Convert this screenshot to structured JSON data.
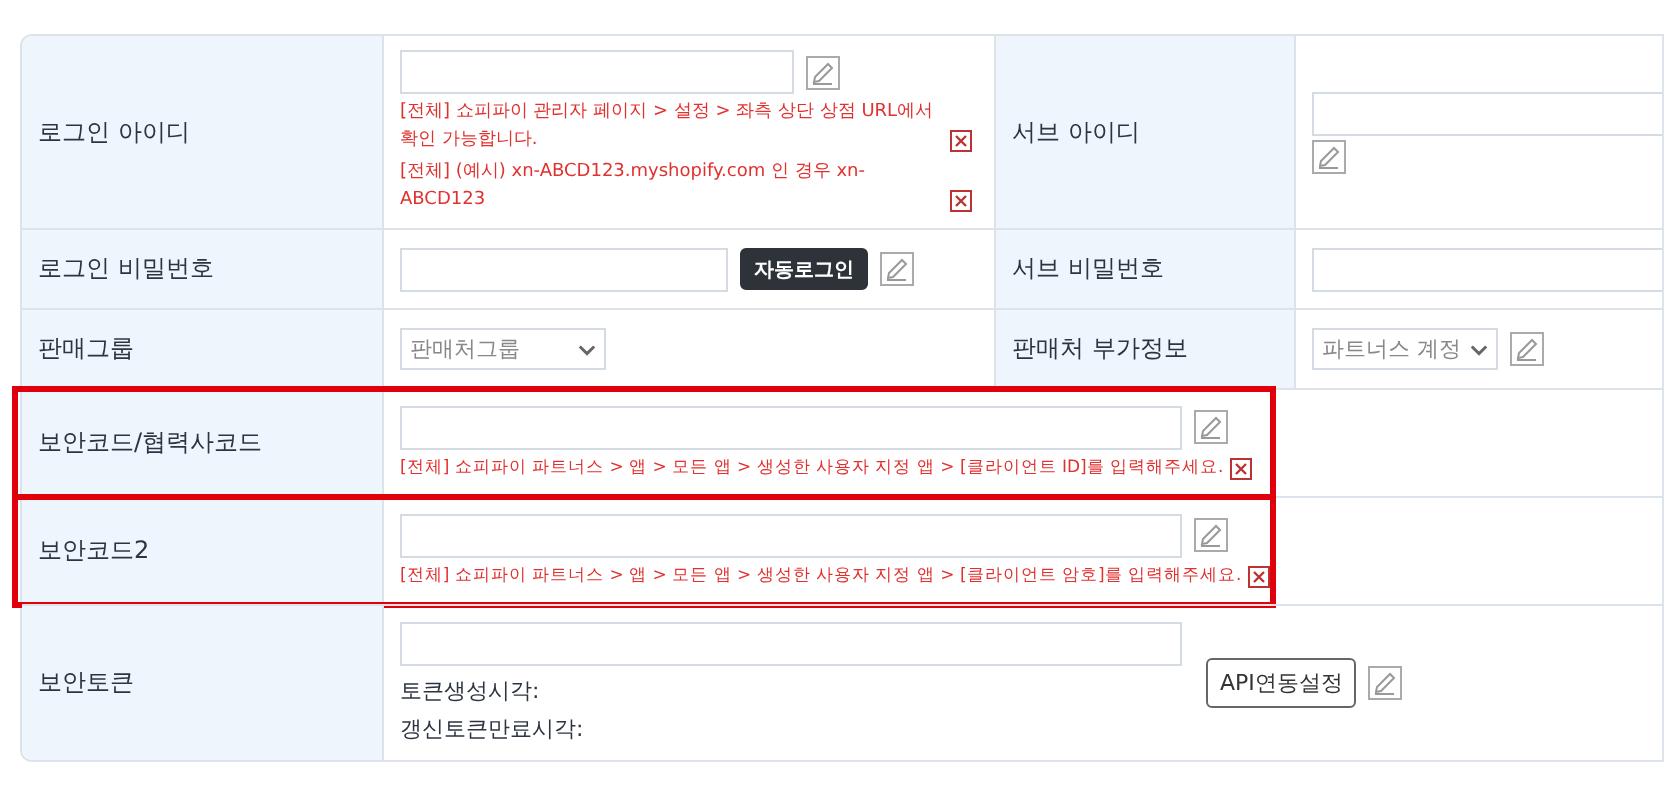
{
  "rows": [
    {
      "highlighted": false,
      "cells": [
        {
          "kind": "label",
          "text": "로그인 아이디"
        },
        {
          "kind": "value",
          "columns": [
            [
              {
                "kind": "input"
              },
              {
                "kind": "edit"
              },
              {
                "kind": "note",
                "text": "[전체] 쇼피파이 관리자 페이지 > 설정 > 좌측 상단 상점 URL에서 확인 가능합니다."
              },
              {
                "kind": "note",
                "text": "[전체] (예시) xn-ABCD123.myshopify.com 인 경우 xn-ABCD123"
              }
            ]
          ]
        },
        {
          "kind": "label",
          "text": "서브 아이디"
        },
        {
          "kind": "value",
          "columns": [
            [
              {
                "kind": "input"
              },
              {
                "kind": "edit"
              }
            ]
          ]
        }
      ]
    },
    {
      "highlighted": false,
      "cells": [
        {
          "kind": "label",
          "text": "로그인 비밀번호"
        },
        {
          "kind": "value",
          "columns": [
            [
              {
                "kind": "input"
              },
              {
                "kind": "button",
                "text": "자동로그인"
              },
              {
                "kind": "edit"
              }
            ]
          ]
        },
        {
          "kind": "label",
          "text": "서브 비밀번호"
        },
        {
          "kind": "value",
          "columns": [
            [
              {
                "kind": "input"
              }
            ]
          ]
        }
      ]
    },
    {
      "highlighted": false,
      "cells": [
        {
          "kind": "label",
          "text": "판매그룹"
        },
        {
          "kind": "value",
          "columns": [
            [
              {
                "kind": "select",
                "text": "판매처그룹"
              }
            ]
          ]
        },
        {
          "kind": "label",
          "text": "판매처 부가정보"
        },
        {
          "kind": "value",
          "columns": [
            [
              {
                "kind": "select",
                "text": "파트너스 계정"
              },
              {
                "kind": "edit"
              }
            ]
          ]
        }
      ]
    },
    {
      "highlighted": true,
      "cells": [
        {
          "kind": "label",
          "text": "보안코드/협력사코드"
        },
        {
          "kind": "value",
          "columns": [
            [
              {
                "kind": "input"
              },
              {
                "kind": "edit"
              },
              {
                "kind": "note",
                "text": "[전체] 쇼피파이 파트너스 > 앱 > 모든 앱 > 생성한 사용자 지정 앱 > [클라이언트 ID]를 입력해주세요."
              }
            ]
          ]
        }
      ]
    },
    {
      "highlighted": true,
      "cells": [
        {
          "kind": "label",
          "text": "보안코드2"
        },
        {
          "kind": "value",
          "columns": [
            [
              {
                "kind": "input"
              },
              {
                "kind": "edit"
              },
              {
                "kind": "note",
                "text": "[전체] 쇼피파이 파트너스 > 앱 > 모든 앱 > 생성한 사용자 지정 앱 > [클라이언트 암호]를 입력해주세요."
              }
            ]
          ]
        }
      ]
    },
    {
      "highlighted": false,
      "cells": [
        {
          "kind": "label",
          "text": "보안토큰"
        },
        {
          "kind": "value",
          "columns": [
            [
              {
                "kind": "input"
              },
              {
                "kind": "text",
                "text": "토큰생성시각:"
              },
              {
                "kind": "text",
                "text": "갱신토큰만료시각:"
              }
            ],
            [
              {
                "kind": "button",
                "text": "API연동설정"
              },
              {
                "kind": "edit"
              }
            ]
          ]
        }
      ]
    }
  ]
}
